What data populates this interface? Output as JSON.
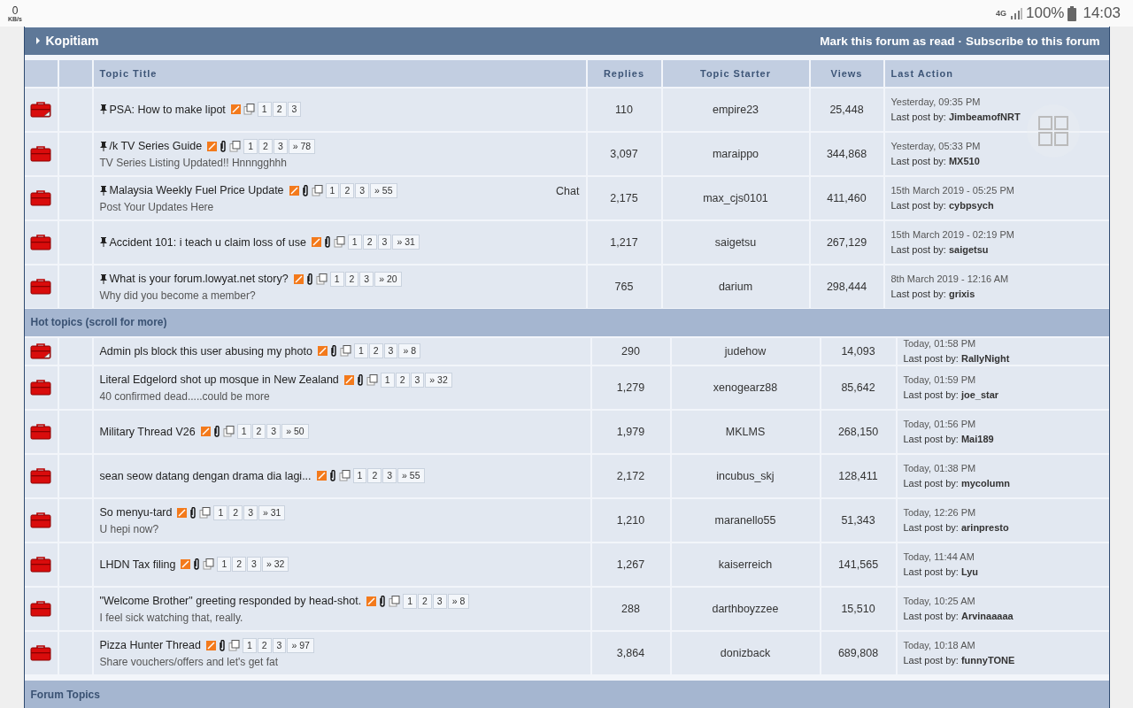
{
  "status_bar": {
    "net_speed": "0",
    "net_unit": "KB/s",
    "network": "4G",
    "battery": "100%",
    "time": "14:03"
  },
  "forum": {
    "title": "Kopitiam",
    "actions": [
      "Mark this forum as read",
      "Subscribe to this forum"
    ],
    "separator": "·"
  },
  "columns": [
    "Topic Title",
    "Replies",
    "Topic Starter",
    "Views",
    "Last Action"
  ],
  "pinned_topics": [
    {
      "unread": true,
      "pinned": true,
      "title": "PSA: How to make lipot",
      "attachment": false,
      "pages": [
        "1",
        "2",
        "3"
      ],
      "replies": "110",
      "starter": "empire23",
      "views": "25,448",
      "time": "Yesterday, 09:35 PM",
      "last_post": "Last post by: **JimbeamofNRT**"
    },
    {
      "unread": false,
      "pinned": true,
      "title": "/k TV Series Guide",
      "subtitle": "TV Series Listing Updated!! Hnnngghhh",
      "attachment": true,
      "pages": [
        "1",
        "2",
        "3",
        "» 78"
      ],
      "replies": "3,097",
      "starter": "maraippo",
      "views": "344,868",
      "time": "Yesterday, 05:33 PM",
      "last_post": "Last post by: **MX510**"
    },
    {
      "unread": false,
      "pinned": true,
      "title": "Malaysia Weekly Fuel Price Update",
      "subtitle": "Post Your Updates Here",
      "tag": "Chat",
      "attachment": true,
      "pages": [
        "1",
        "2",
        "3",
        "» 55"
      ],
      "replies": "2,175",
      "starter": "max_cjs0101",
      "views": "411,460",
      "time": "15th March 2019 - 05:25 PM",
      "last_post": "Last post by: **cybpsych**"
    },
    {
      "unread": false,
      "pinned": true,
      "title": "Accident 101: i teach u claim loss of use",
      "attachment": true,
      "pages": [
        "1",
        "2",
        "3",
        "» 31"
      ],
      "replies": "1,217",
      "starter": "saigetsu",
      "views": "267,129",
      "time": "15th March 2019 - 02:19 PM",
      "last_post": "Last post by: **saigetsu**"
    },
    {
      "unread": false,
      "pinned": true,
      "title": "What is your forum.lowyat.net story?",
      "subtitle": "Why did you become a member?",
      "attachment": true,
      "pages": [
        "1",
        "2",
        "3",
        "» 20"
      ],
      "replies": "765",
      "starter": "darium",
      "views": "298,444",
      "time": "8th March 2019 - 12:16 AM",
      "last_post": "Last post by: **grixis**"
    }
  ],
  "hot_topics": {
    "title": "Hot topics (scroll for more)",
    "rows": [
      {
        "unread": true,
        "pinned": false,
        "title": "Admin pls block this user abusing my photo",
        "attachment": true,
        "pages": [
          "1",
          "2",
          "3",
          "» 8"
        ],
        "replies": "290",
        "starter": "judehow",
        "views": "14,093",
        "time": "Today, 01:58 PM",
        "last_post": "Last post by: **RallyNight**"
      },
      {
        "unread": false,
        "pinned": false,
        "title": "Literal Edgelord shot up mosque in New Zealand",
        "subtitle": "40 confirmed dead.....could be more",
        "attachment": true,
        "pages": [
          "1",
          "2",
          "3",
          "» 32"
        ],
        "replies": "1,279",
        "starter": "xenogearz88",
        "views": "85,642",
        "time": "Today, 01:59 PM",
        "last_post": "Last post by: **joe_star**"
      },
      {
        "unread": false,
        "pinned": false,
        "title": "Military Thread V26",
        "attachment": true,
        "pages": [
          "1",
          "2",
          "3",
          "» 50"
        ],
        "replies": "1,979",
        "starter": "MKLMS",
        "views": "268,150",
        "time": "Today, 01:56 PM",
        "last_post": "Last post by: **Mai189**"
      },
      {
        "unread": false,
        "pinned": false,
        "title": "sean seow datang dengan drama dia lagi...",
        "attachment": true,
        "pages": [
          "1",
          "2",
          "3",
          "» 55"
        ],
        "replies": "2,172",
        "starter": "incubus_skj",
        "views": "128,411",
        "time": "Today, 01:38 PM",
        "last_post": "Last post by: **mycolumn**"
      },
      {
        "unread": false,
        "pinned": false,
        "title": "So menyu-tard",
        "subtitle": "U hepi now?",
        "attachment": true,
        "pages": [
          "1",
          "2",
          "3",
          "» 31"
        ],
        "replies": "1,210",
        "starter": "maranello55",
        "views": "51,343",
        "time": "Today, 12:26 PM",
        "last_post": "Last post by: **arinpresto**"
      },
      {
        "unread": false,
        "pinned": false,
        "title": "LHDN Tax filing",
        "attachment": true,
        "pages": [
          "1",
          "2",
          "3",
          "» 32"
        ],
        "replies": "1,267",
        "starter": "kaiserreich",
        "views": "141,565",
        "time": "Today, 11:44 AM",
        "last_post": "Last post by: **Lyu**"
      },
      {
        "unread": false,
        "pinned": false,
        "title": "\"Welcome Brother\" greeting responded by head-shot.",
        "subtitle": "I feel sick watching that, really.",
        "attachment": true,
        "pages": [
          "1",
          "2",
          "3",
          "» 8"
        ],
        "replies": "288",
        "starter": "darthboyzzee",
        "views": "15,510",
        "time": "Today, 10:25 AM",
        "last_post": "Last post by: **Arvinaaaaa**"
      },
      {
        "unread": false,
        "pinned": false,
        "title": "Pizza Hunter Thread",
        "subtitle": "Share vouchers/offers and let's get fat",
        "attachment": true,
        "pages": [
          "1",
          "2",
          "3",
          "» 97"
        ],
        "replies": "3,864",
        "starter": "donizback",
        "views": "689,808",
        "time": "Today, 10:18 AM",
        "last_post": "Last post by: **funnyTONE**"
      }
    ]
  },
  "forum_topics": {
    "title": "Forum Topics"
  }
}
